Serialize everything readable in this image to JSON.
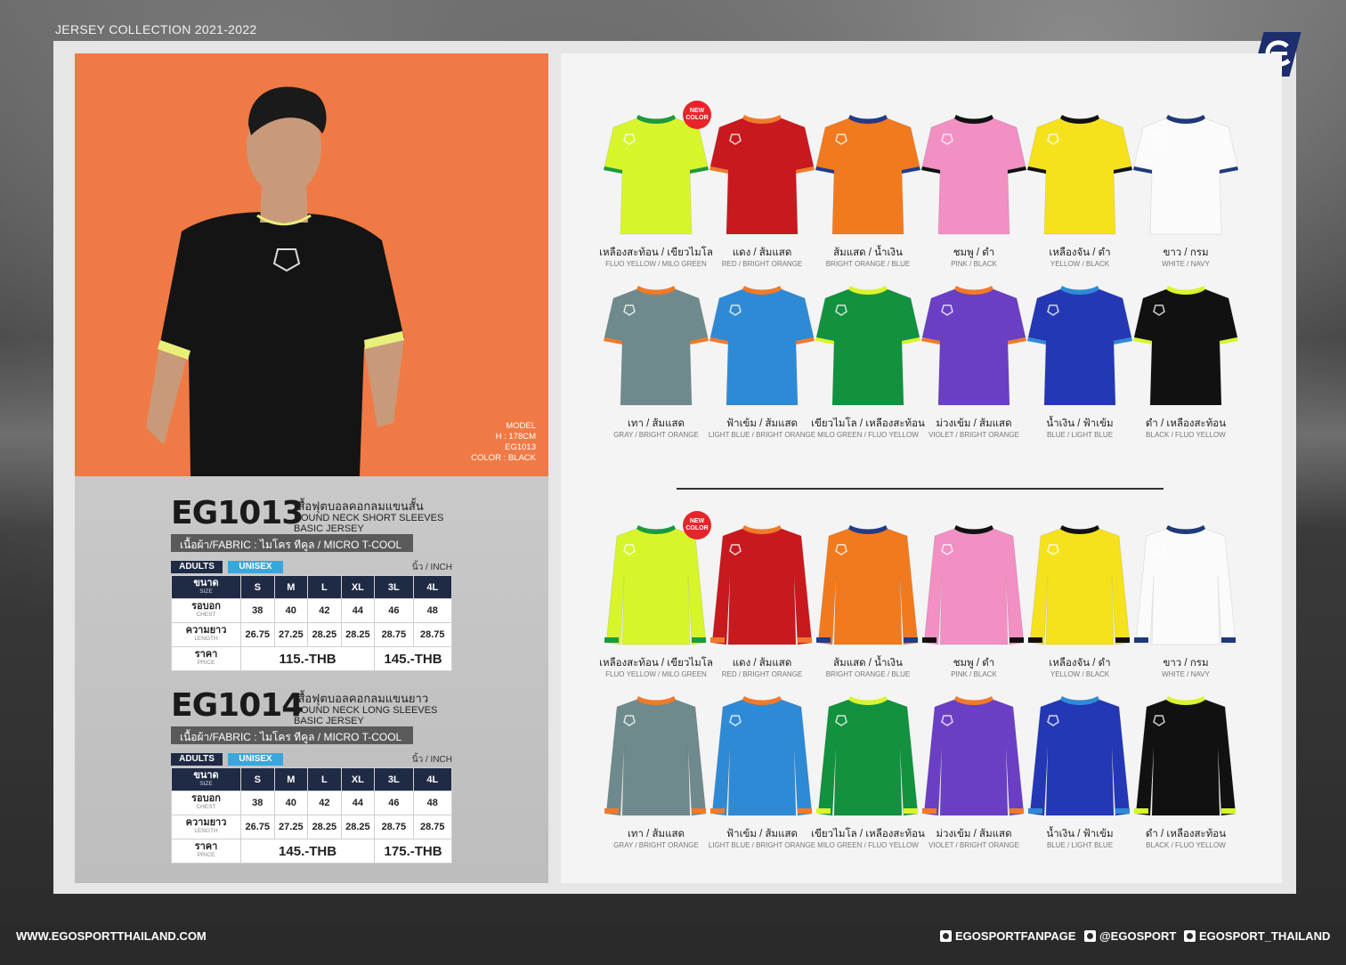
{
  "header": {
    "collection": "JERSEY COLLECTION 2021-2022",
    "logo_icon": "ego-logo-icon"
  },
  "model": {
    "line1": "MODEL",
    "line2": "H : 178CM",
    "line3": "EG1013",
    "line4": "COLOR : BLACK"
  },
  "labels": {
    "new_badge_1": "NEW",
    "new_badge_2": "COLOR"
  },
  "products": [
    {
      "code": "EG1013",
      "name_th": "เสื้อฟุตบอลคอกลมแขนสั้น",
      "name_en": "ROUND NECK SHORT SLEEVES BASIC JERSEY",
      "fabric": "เนื้อผ้า/FABRIC : ไมโคร ทีคูล / MICRO T-COOL",
      "tag_adults": "ADULTS",
      "tag_unisex": "UNISEX",
      "unit": "นิ้ว / INCH",
      "size_th": "ขนาด",
      "size_en": "SIZE",
      "sizes": [
        "S",
        "M",
        "L",
        "XL",
        "3L",
        "4L"
      ],
      "chest_th": "รอบอก",
      "chest_en": "CHEST",
      "chest": [
        "38",
        "40",
        "42",
        "44",
        "46",
        "48"
      ],
      "length_th": "ความยาว",
      "length_en": "LENGTH",
      "length": [
        "26.75",
        "27.25",
        "28.25",
        "28.25",
        "28.75",
        "28.75"
      ],
      "price_th": "ราคา",
      "price_en": "PRICE",
      "price_a": "115.-THB",
      "price_b": "145.-THB"
    },
    {
      "code": "EG1014",
      "name_th": "เสื้อฟุตบอลคอกลมแขนยาว",
      "name_en": "ROUND NECK LONG SLEEVES BASIC JERSEY",
      "fabric": "เนื้อผ้า/FABRIC : ไมโคร ทีคูล / MICRO T-COOL",
      "tag_adults": "ADULTS",
      "tag_unisex": "UNISEX",
      "unit": "นิ้ว / INCH",
      "size_th": "ขนาด",
      "size_en": "SIZE",
      "sizes": [
        "S",
        "M",
        "L",
        "XL",
        "3L",
        "4L"
      ],
      "chest_th": "รอบอก",
      "chest_en": "CHEST",
      "chest": [
        "38",
        "40",
        "42",
        "44",
        "46",
        "48"
      ],
      "length_th": "ความยาว",
      "length_en": "LENGTH",
      "length": [
        "26.75",
        "27.25",
        "28.25",
        "28.25",
        "28.75",
        "28.75"
      ],
      "price_th": "ราคา",
      "price_en": "PRICE",
      "price_a": "145.-THB",
      "price_b": "175.-THB"
    }
  ],
  "colors": [
    {
      "th": "เหลืองสะท้อน / เขียวไมโล",
      "en": "FLUO YELLOW / MILO GREEN",
      "body": "#d8f52c",
      "trim": "#1c9a3c",
      "new": true
    },
    {
      "th": "แดง / ส้มแสด",
      "en": "RED / BRIGHT ORANGE",
      "body": "#c8191f",
      "trim": "#f07a2a",
      "new": false
    },
    {
      "th": "ส้มแสด / น้ำเงิน",
      "en": "BRIGHT ORANGE / BLUE",
      "body": "#f27a1e",
      "trim": "#243a8a",
      "new": false
    },
    {
      "th": "ชมพู / ดำ",
      "en": "PINK / BLACK",
      "body": "#f28fc3",
      "trim": "#111111",
      "new": false
    },
    {
      "th": "เหลืองจัน / ดำ",
      "en": "YELLOW / BLACK",
      "body": "#f5e21c",
      "trim": "#111111",
      "new": false
    },
    {
      "th": "ขาว / กรม",
      "en": "WHITE / NAVY",
      "body": "#fbfbfb",
      "trim": "#1f3a7a",
      "new": false
    },
    {
      "th": "เทา / ส้มแสด",
      "en": "GRAY / BRIGHT ORANGE",
      "body": "#6f8a8c",
      "trim": "#f07a2a",
      "new": false
    },
    {
      "th": "ฟ้าเข้ม / ส้มแสด",
      "en": "LIGHT BLUE / BRIGHT ORANGE",
      "body": "#2f8ad6",
      "trim": "#f07a2a",
      "new": false
    },
    {
      "th": "เขียวไมโล / เหลืองสะท้อน",
      "en": "MILO GREEN / FLUO YELLOW",
      "body": "#12913f",
      "trim": "#d8f52c",
      "new": false
    },
    {
      "th": "ม่วงเข้ม / ส้มแสด",
      "en": "VIOLET / BRIGHT ORANGE",
      "body": "#6a3fc4",
      "trim": "#f07a2a",
      "new": false
    },
    {
      "th": "น้ำเงิน / ฟ้าเข้ม",
      "en": "BLUE / LIGHT BLUE",
      "body": "#2438b5",
      "trim": "#2f8ad6",
      "new": false
    },
    {
      "th": "ดำ / เหลืองสะท้อน",
      "en": "BLACK / FLUO YELLOW",
      "body": "#111111",
      "trim": "#d8f52c",
      "new": false
    }
  ],
  "footer": {
    "website": "WWW.EGOSPORTTHAILAND.COM",
    "facebook": "EGOSPORTFANPAGE",
    "line": "@EGOSPORT",
    "instagram": "EGOSPORT_THAILAND"
  },
  "theme": {
    "photo_bg": "#f07a45",
    "navy": "#1f2a44",
    "unisex_blue": "#39a7dd"
  }
}
